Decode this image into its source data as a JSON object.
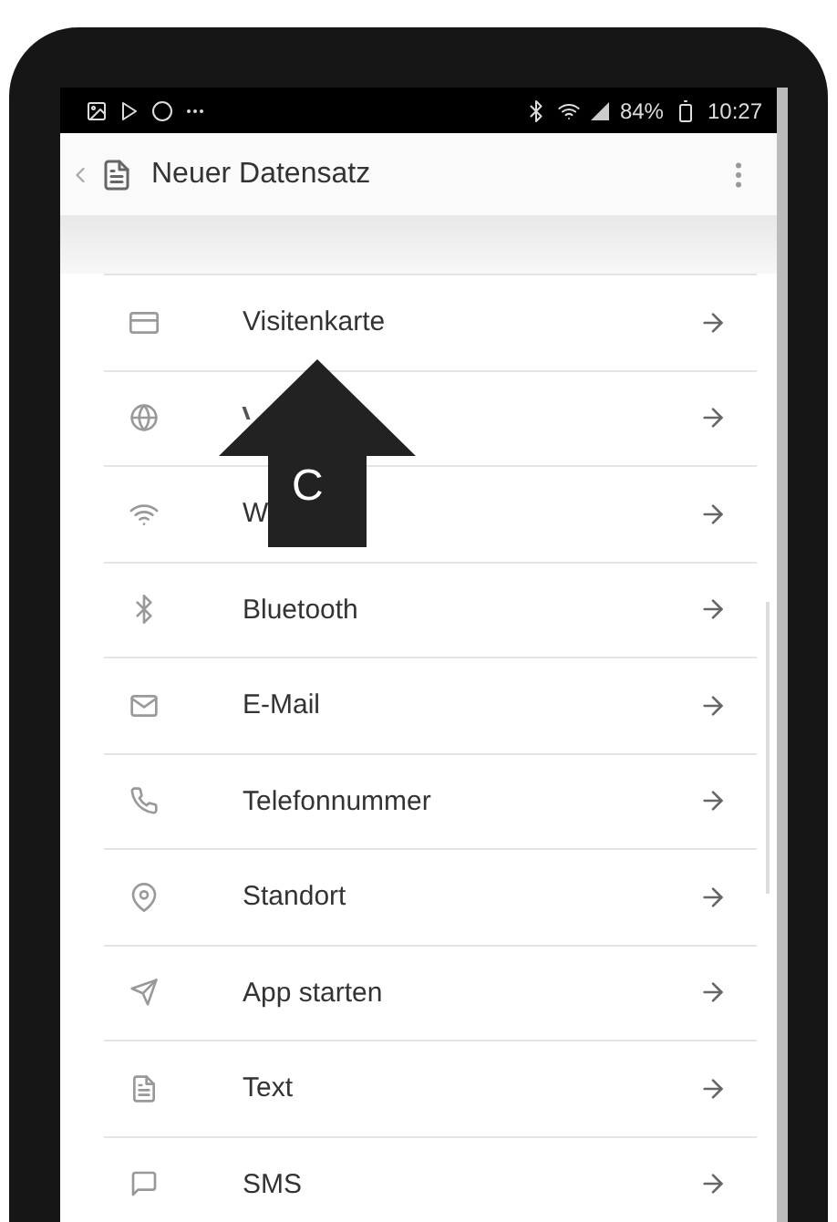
{
  "status_bar": {
    "battery": "84%",
    "time": "10:27"
  },
  "app_bar": {
    "title": "Neuer Datensatz"
  },
  "items": [
    {
      "label": "Visitenkarte",
      "covered": false
    },
    {
      "covered": true
    },
    {
      "label": "W",
      "covered": false
    },
    {
      "label": "Bluetooth",
      "covered": false
    },
    {
      "label": "E-Mail",
      "covered": false
    },
    {
      "label": "Telefonnummer",
      "covered": false
    },
    {
      "label": "Standort",
      "covered": false
    },
    {
      "label": "App starten",
      "covered": false
    },
    {
      "label": "Text",
      "covered": false
    },
    {
      "label": "SMS",
      "covered": false
    }
  ],
  "annotation": {
    "label": "C"
  }
}
